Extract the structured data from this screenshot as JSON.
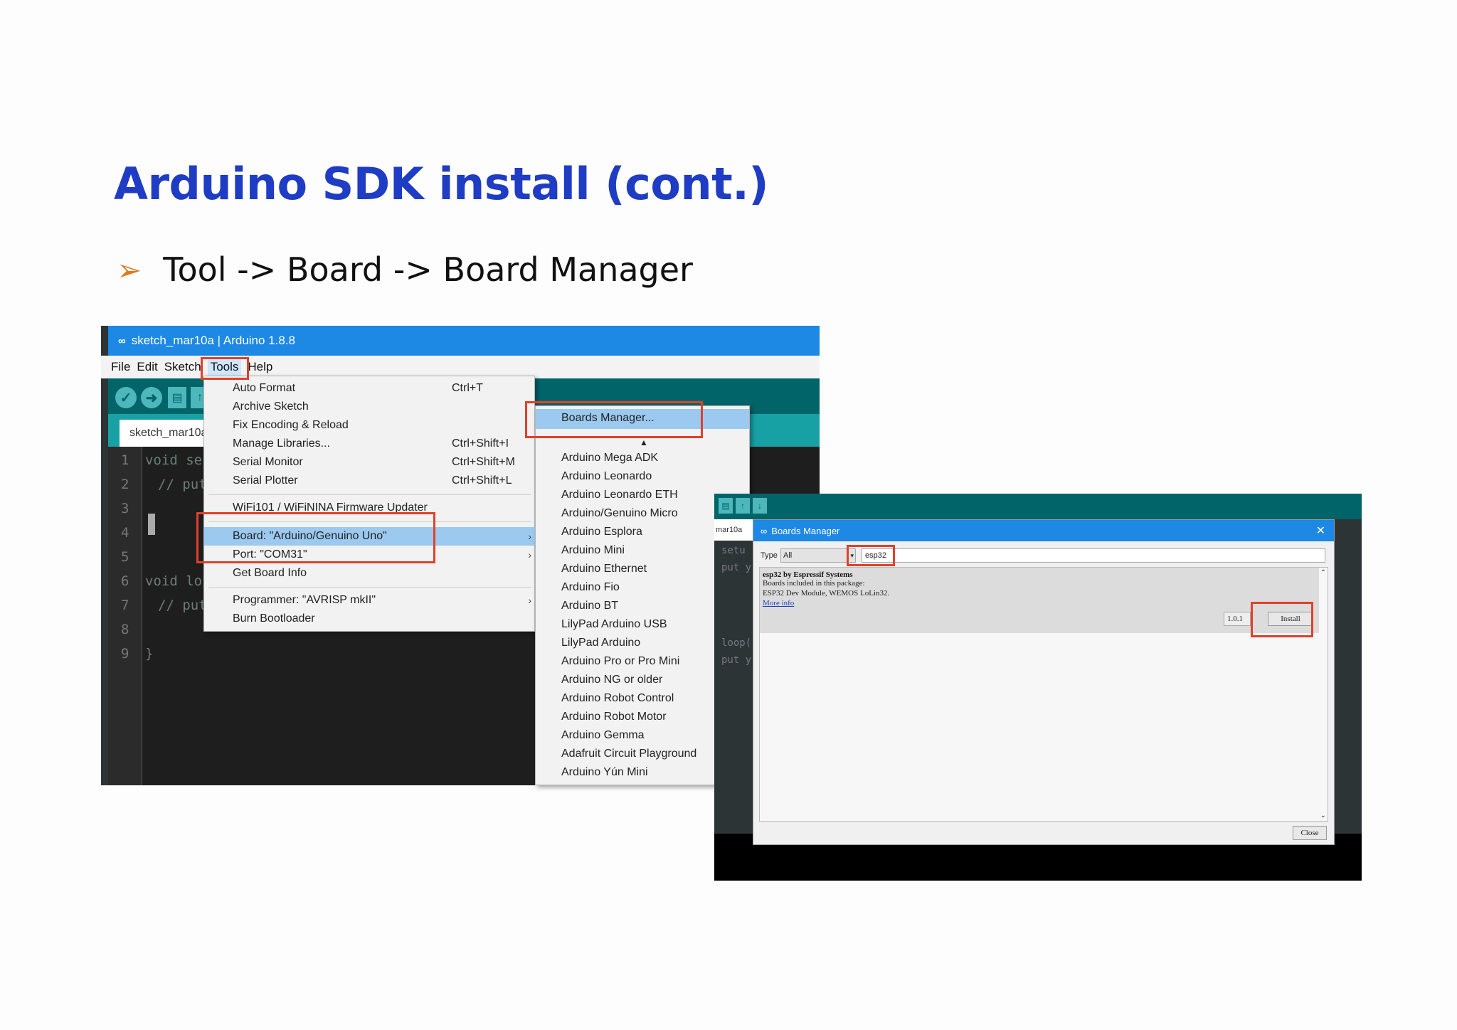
{
  "slide": {
    "title": "Arduino SDK install (cont.)",
    "bullet": "Tool -> Board -> Board Manager"
  },
  "ide": {
    "window_title": "sketch_mar10a | Arduino 1.8.8",
    "menu": [
      "File",
      "Edit",
      "Sketch",
      "Tools",
      "Help"
    ],
    "tab": "sketch_mar10a",
    "line_numbers": [
      "1",
      "2",
      "3",
      "4",
      "5",
      "6",
      "7",
      "8",
      "9"
    ],
    "code_lines": {
      "l1": "void se",
      "l2": "// put",
      "l6": "void lo",
      "l7": "// put",
      "l9": "}"
    },
    "tools_menu": {
      "auto_format": {
        "label": "Auto Format",
        "shortcut": "Ctrl+T"
      },
      "archive_sketch": {
        "label": "Archive Sketch"
      },
      "fix_encoding": {
        "label": "Fix Encoding & Reload"
      },
      "manage_libraries": {
        "label": "Manage Libraries...",
        "shortcut": "Ctrl+Shift+I"
      },
      "serial_monitor": {
        "label": "Serial Monitor",
        "shortcut": "Ctrl+Shift+M"
      },
      "serial_plotter": {
        "label": "Serial Plotter",
        "shortcut": "Ctrl+Shift+L"
      },
      "wifi_updater": {
        "label": "WiFi101 / WiFiNINA Firmware Updater"
      },
      "board": {
        "label": "Board: \"Arduino/Genuino Uno\""
      },
      "port": {
        "label": "Port: \"COM31\""
      },
      "board_info": {
        "label": "Get Board Info"
      },
      "programmer": {
        "label": "Programmer: \"AVRISP mkII\""
      },
      "burn_bootloader": {
        "label": "Burn Bootloader"
      }
    },
    "board_menu": {
      "boards_manager": "Boards Manager...",
      "boards": [
        "Arduino Mega ADK",
        "Arduino Leonardo",
        "Arduino Leonardo ETH",
        "Arduino/Genuino Micro",
        "Arduino Esplora",
        "Arduino Mini",
        "Arduino Ethernet",
        "Arduino Fio",
        "Arduino BT",
        "LilyPad Arduino USB",
        "LilyPad Arduino",
        "Arduino Pro or Pro Mini",
        "Arduino NG or older",
        "Arduino Robot Control",
        "Arduino Robot Motor",
        "Arduino Gemma",
        "Adafruit Circuit Playground",
        "Arduino Yún Mini"
      ]
    }
  },
  "boards_manager": {
    "bg_tab": "mar10a",
    "bg_code": {
      "a": "setu",
      "b": "put y",
      "c": "loop(",
      "d": "put y"
    },
    "title": "Boards Manager",
    "type_label": "Type",
    "type_value": "All",
    "search_value": "esp32",
    "package": {
      "title": "esp32 by Espressif Systems",
      "included": "Boards included in this package:",
      "boards": "ESP32 Dev Module, WEMOS LoLin32.",
      "more_info": "More info"
    },
    "version": "1.0.1",
    "install_label": "Install",
    "close_label": "Close"
  },
  "colors": {
    "title_blue": "#1f3cc4",
    "bullet_orange": "#e07a1f",
    "highlight_red": "#e2402a",
    "arduino_teal": "#006468",
    "titlebar_blue": "#1e88e5"
  }
}
